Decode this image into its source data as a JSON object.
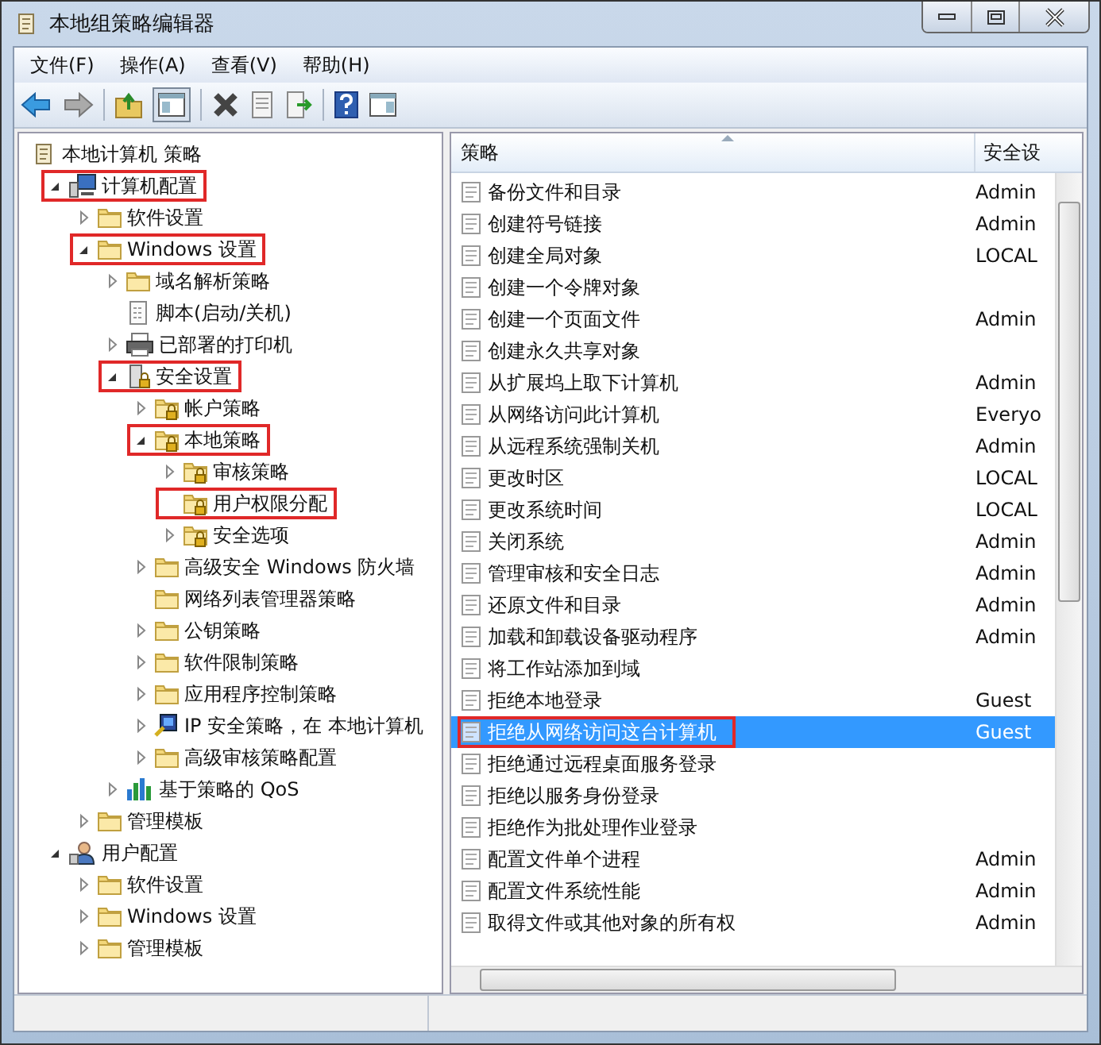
{
  "window": {
    "title": "本地组策略编辑器"
  },
  "menu": [
    {
      "label": "文件(F)"
    },
    {
      "label": "操作(A)"
    },
    {
      "label": "查看(V)"
    },
    {
      "label": "帮助(H)"
    }
  ],
  "tree": {
    "label": "本地计算机 策略",
    "kind": "scroll",
    "highlighted": false,
    "children": [
      {
        "label": "计算机配置",
        "kind": "computer",
        "expanded": true,
        "highlighted": true,
        "children": [
          {
            "label": "软件设置",
            "kind": "folder",
            "expanded": false,
            "highlighted": false
          },
          {
            "label": "Windows 设置",
            "kind": "folder",
            "expanded": true,
            "highlighted": true,
            "children": [
              {
                "label": "域名解析策略",
                "kind": "folder",
                "expanded": false,
                "highlighted": false
              },
              {
                "label": "脚本(启动/关机)",
                "kind": "script",
                "highlighted": false
              },
              {
                "label": "已部署的打印机",
                "kind": "printer",
                "expanded": false,
                "highlighted": false
              },
              {
                "label": "安全设置",
                "kind": "security",
                "expanded": true,
                "highlighted": true,
                "children": [
                  {
                    "label": "帐户策略",
                    "kind": "lockfolder",
                    "expanded": false,
                    "highlighted": false
                  },
                  {
                    "label": "本地策略",
                    "kind": "lockfolder",
                    "expanded": true,
                    "highlighted": true,
                    "children": [
                      {
                        "label": "审核策略",
                        "kind": "lockfolder",
                        "expanded": false,
                        "highlighted": false
                      },
                      {
                        "label": "用户权限分配",
                        "kind": "lockfolder",
                        "highlighted": true
                      },
                      {
                        "label": "安全选项",
                        "kind": "lockfolder",
                        "expanded": false,
                        "highlighted": false
                      }
                    ]
                  },
                  {
                    "label": "高级安全 Windows 防火墙",
                    "kind": "folder",
                    "expanded": false,
                    "highlighted": false
                  },
                  {
                    "label": "网络列表管理器策略",
                    "kind": "folder",
                    "highlighted": false
                  },
                  {
                    "label": "公钥策略",
                    "kind": "folder",
                    "expanded": false,
                    "highlighted": false
                  },
                  {
                    "label": "软件限制策略",
                    "kind": "folder",
                    "expanded": false,
                    "highlighted": false
                  },
                  {
                    "label": "应用程序控制策略",
                    "kind": "folder",
                    "expanded": false,
                    "highlighted": false
                  },
                  {
                    "label": "IP 安全策略，在 本地计算机",
                    "kind": "ip",
                    "expanded": false,
                    "highlighted": false
                  },
                  {
                    "label": "高级审核策略配置",
                    "kind": "folder",
                    "expanded": false,
                    "highlighted": false
                  }
                ]
              },
              {
                "label": "基于策略的 QoS",
                "kind": "chart",
                "expanded": false,
                "highlighted": false
              }
            ]
          },
          {
            "label": "管理模板",
            "kind": "folder",
            "expanded": false,
            "highlighted": false
          }
        ]
      },
      {
        "label": "用户配置",
        "kind": "user",
        "expanded": true,
        "highlighted": false,
        "children": [
          {
            "label": "软件设置",
            "kind": "folder",
            "expanded": false,
            "highlighted": false
          },
          {
            "label": "Windows 设置",
            "kind": "folder",
            "expanded": false,
            "highlighted": false
          },
          {
            "label": "管理模板",
            "kind": "folder",
            "expanded": false,
            "highlighted": false
          }
        ]
      }
    ]
  },
  "table": {
    "columns": [
      "策略",
      "安全设"
    ],
    "rows": [
      {
        "policy": "备份文件和目录",
        "setting": "Admin",
        "selected": false,
        "highlighted": false
      },
      {
        "policy": "创建符号链接",
        "setting": "Admin",
        "selected": false,
        "highlighted": false
      },
      {
        "policy": "创建全局对象",
        "setting": "LOCAL",
        "selected": false,
        "highlighted": false
      },
      {
        "policy": "创建一个令牌对象",
        "selected": false,
        "highlighted": false
      },
      {
        "policy": "创建一个页面文件",
        "setting": "Admin",
        "selected": false,
        "highlighted": false
      },
      {
        "policy": "创建永久共享对象",
        "selected": false,
        "highlighted": false
      },
      {
        "policy": "从扩展坞上取下计算机",
        "setting": "Admin",
        "selected": false,
        "highlighted": false
      },
      {
        "policy": "从网络访问此计算机",
        "setting": "Everyo",
        "selected": false,
        "highlighted": false
      },
      {
        "policy": "从远程系统强制关机",
        "setting": "Admin",
        "selected": false,
        "highlighted": false
      },
      {
        "policy": "更改时区",
        "setting": "LOCAL",
        "selected": false,
        "highlighted": false
      },
      {
        "policy": "更改系统时间",
        "setting": "LOCAL",
        "selected": false,
        "highlighted": false
      },
      {
        "policy": "关闭系统",
        "setting": "Admin",
        "selected": false,
        "highlighted": false
      },
      {
        "policy": "管理审核和安全日志",
        "setting": "Admin",
        "selected": false,
        "highlighted": false
      },
      {
        "policy": "还原文件和目录",
        "setting": "Admin",
        "selected": false,
        "highlighted": false
      },
      {
        "policy": "加载和卸载设备驱动程序",
        "setting": "Admin",
        "selected": false,
        "highlighted": false
      },
      {
        "policy": "将工作站添加到域",
        "selected": false,
        "highlighted": false
      },
      {
        "policy": "拒绝本地登录",
        "setting": "Guest",
        "selected": false,
        "highlighted": false
      },
      {
        "policy": "拒绝从网络访问这台计算机",
        "setting": "Guest",
        "selected": true,
        "highlighted": true
      },
      {
        "policy": "拒绝通过远程桌面服务登录",
        "selected": false,
        "highlighted": false
      },
      {
        "policy": "拒绝以服务身份登录",
        "selected": false,
        "highlighted": false
      },
      {
        "policy": "拒绝作为批处理作业登录",
        "selected": false,
        "highlighted": false
      },
      {
        "policy": "配置文件单个进程",
        "setting": "Admin",
        "selected": false,
        "highlighted": false
      },
      {
        "policy": "配置文件系统性能",
        "setting": "Admin",
        "selected": false,
        "highlighted": false
      },
      {
        "policy": "取得文件或其他对象的所有权",
        "setting": "Admin",
        "selected": false,
        "highlighted": false
      }
    ]
  }
}
